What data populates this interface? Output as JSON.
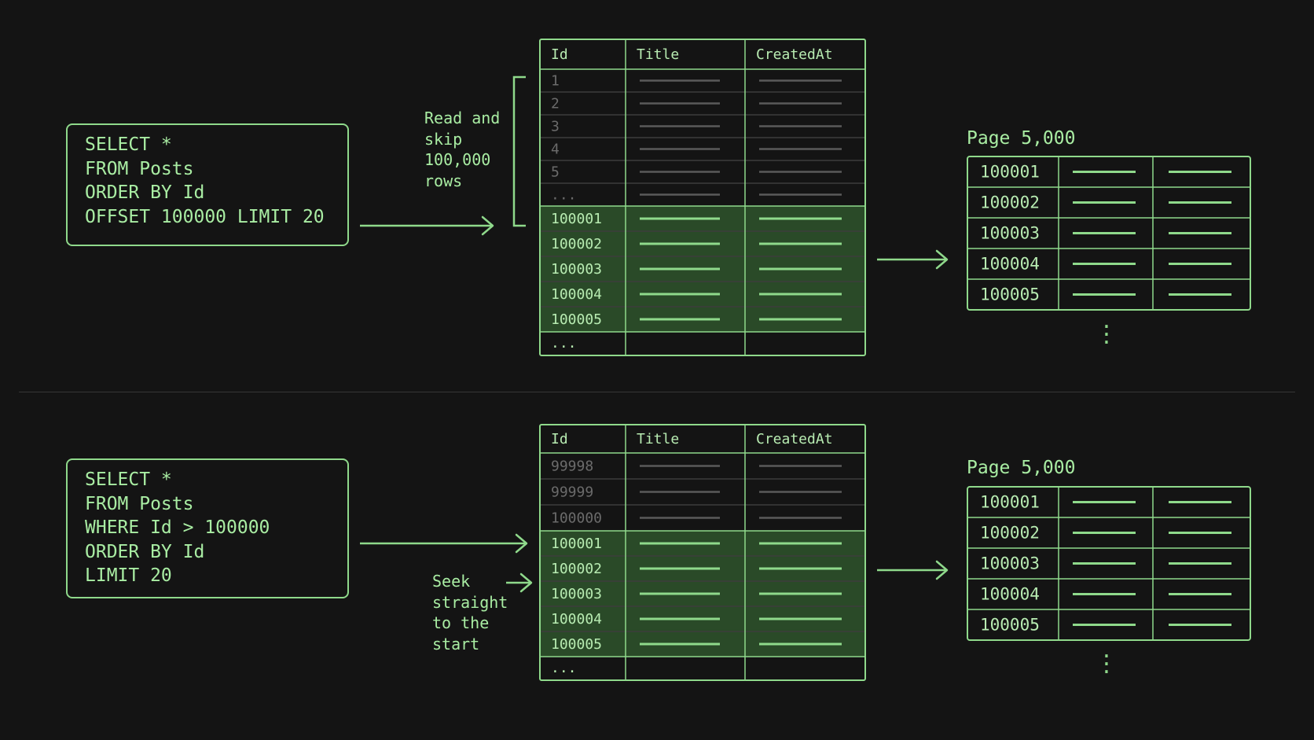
{
  "colors": {
    "background": "#141414",
    "accent": "#8fd98b",
    "highlight_fill": "#2a4a28",
    "dim_text": "#6b6b6b",
    "grid": "#3a3a3a"
  },
  "top": {
    "query": [
      "SELECT *",
      "FROM Posts",
      "ORDER BY Id",
      "OFFSET 100000 LIMIT 20"
    ],
    "note": [
      "Read and",
      "skip",
      "100,000",
      "rows"
    ],
    "table": {
      "headers": [
        "Id",
        "Title",
        "CreatedAt"
      ],
      "skipped_ids": [
        "1",
        "2",
        "3",
        "4",
        "5",
        "..."
      ],
      "selected_ids": [
        "100001",
        "100002",
        "100003",
        "100004",
        "100005"
      ],
      "tail": "..."
    },
    "result": {
      "title": "Page 5,000",
      "ids": [
        "100001",
        "100002",
        "100003",
        "100004",
        "100005"
      ],
      "more": "⋮"
    }
  },
  "bottom": {
    "query": [
      "SELECT *",
      "FROM Posts",
      "WHERE Id > 100000",
      "ORDER BY Id",
      "LIMIT 20"
    ],
    "note": [
      "Seek",
      "straight",
      "to the",
      "start"
    ],
    "table": {
      "headers": [
        "Id",
        "Title",
        "CreatedAt"
      ],
      "skipped_ids": [
        "99998",
        "99999",
        "100000"
      ],
      "selected_ids": [
        "100001",
        "100002",
        "100003",
        "100004",
        "100005"
      ],
      "tail": "..."
    },
    "result": {
      "title": "Page 5,000",
      "ids": [
        "100001",
        "100002",
        "100003",
        "100004",
        "100005"
      ],
      "more": "⋮"
    }
  }
}
